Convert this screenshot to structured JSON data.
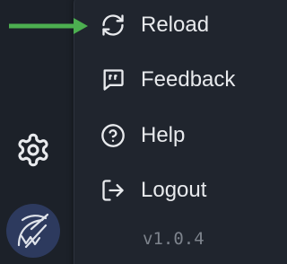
{
  "menu": {
    "items": [
      {
        "label": "Reload",
        "icon": "reload-icon"
      },
      {
        "label": "Feedback",
        "icon": "feedback-icon"
      },
      {
        "label": "Help",
        "icon": "help-icon"
      },
      {
        "label": "Logout",
        "icon": "logout-icon"
      }
    ],
    "version": "v1.0.4"
  },
  "sidebar": {
    "settings_icon": "gear-icon",
    "avatar_icon": "avatar-icon"
  },
  "annotation": {
    "arrow_icon": "arrow-right-icon",
    "arrow_color": "#4caf50"
  },
  "colors": {
    "background": "#1c2129",
    "menu_background": "#20252e",
    "text": "#e8eaed",
    "muted_text": "#7d838c",
    "avatar_background": "#2d3a5e"
  }
}
